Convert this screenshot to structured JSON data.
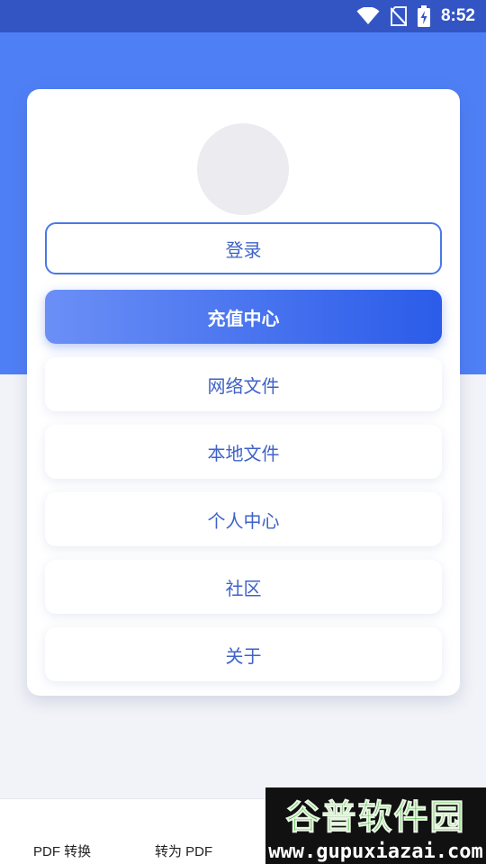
{
  "status_bar": {
    "time": "8:52",
    "icons": [
      "wifi-icon",
      "no-sim-icon",
      "battery-charging-icon"
    ]
  },
  "profile": {
    "avatar": "avatar-placeholder"
  },
  "menu": {
    "login": "登录",
    "recharge": "充值中心",
    "network_files": "网络文件",
    "local_files": "本地文件",
    "personal_center": "个人中心",
    "community": "社区",
    "about": "关于"
  },
  "bottom_tabs": [
    {
      "label": "PDF 转换"
    },
    {
      "label": "转为 PDF"
    }
  ],
  "watermark": {
    "title": "谷普软件园",
    "url": "www.gupuxiazai.com"
  },
  "colors": {
    "status_bar": "#3355c4",
    "hero": "#4f7ff5",
    "accent_text": "#3f62c8",
    "primary_gradient_start": "#6b8ff6",
    "primary_gradient_end": "#2b5ce9"
  }
}
